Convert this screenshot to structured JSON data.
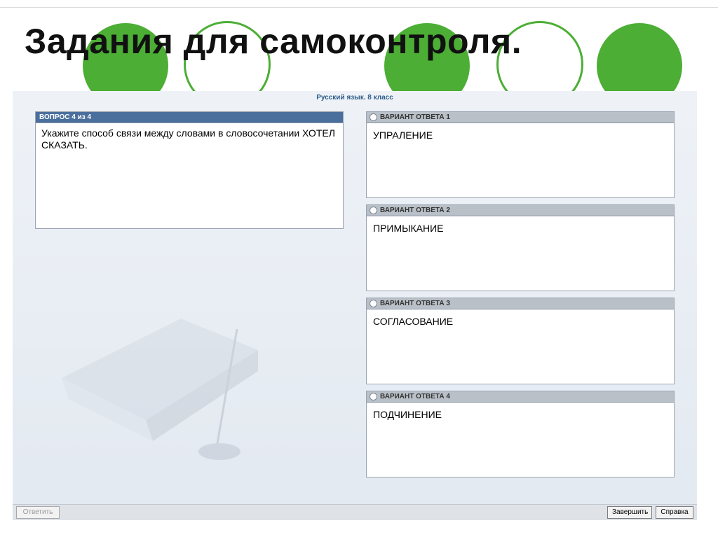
{
  "slide": {
    "title": "Задания для самоконтроля."
  },
  "app": {
    "header": "Русский язык. 8 класс",
    "question": {
      "header": "ВОПРОС 4 из 4",
      "text": "Укажите способ связи между словами в словосочетании ХОТЕЛ СКАЗАТЬ."
    },
    "options": [
      {
        "header": "ВАРИАНТ ОТВЕТА 1",
        "text": "УПРАЛЕНИЕ"
      },
      {
        "header": "ВАРИАНТ ОТВЕТА 2",
        "text": "ПРИМЫКАНИЕ"
      },
      {
        "header": "ВАРИАНТ ОТВЕТА 3",
        "text": "СОГЛАСОВАНИЕ"
      },
      {
        "header": "ВАРИАНТ ОТВЕТА 4",
        "text": "ПОДЧИНЕНИЕ"
      }
    ],
    "buttons": {
      "answer": "Ответить",
      "finish": "Завершить",
      "help": "Справка"
    }
  },
  "colors": {
    "accent_green": "#4cae35",
    "header_blue": "#4a6f9c"
  }
}
